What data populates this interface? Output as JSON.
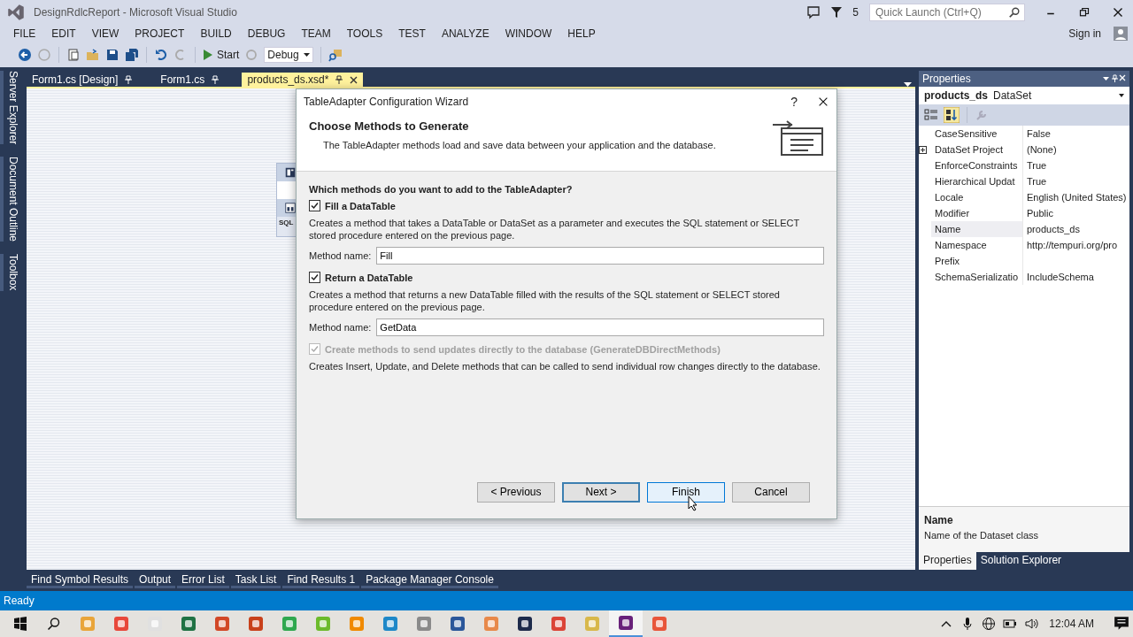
{
  "window": {
    "title": "DesignRdlcReport - Microsoft Visual Studio"
  },
  "notifications": {
    "count": "5"
  },
  "quick_launch": {
    "placeholder": "Quick Launch (Ctrl+Q)"
  },
  "menu": [
    "FILE",
    "EDIT",
    "VIEW",
    "PROJECT",
    "BUILD",
    "DEBUG",
    "TEAM",
    "TOOLS",
    "TEST",
    "ANALYZE",
    "WINDOW",
    "HELP"
  ],
  "sign_in": "Sign in",
  "toolbar": {
    "start": "Start",
    "configuration": "Debug"
  },
  "side_tabs": [
    "Server Explorer",
    "Document Outline",
    "Toolbox"
  ],
  "document_tabs": [
    {
      "label": "Form1.cs [Design]",
      "selected": false
    },
    {
      "label": "Form1.cs",
      "selected": false
    },
    {
      "label": "products_ds.xsd*",
      "selected": true
    }
  ],
  "designer": {
    "sql": "SQL"
  },
  "dialog": {
    "title": "TableAdapter Configuration Wizard",
    "help": "?",
    "heading": "Choose Methods to Generate",
    "description": "The TableAdapter methods load and save data between your application and the database.",
    "question": "Which methods do you want to add to the TableAdapter?",
    "options": [
      {
        "label": "Fill a DataTable",
        "checked": true,
        "disabled": false,
        "description": "Creates a method that takes a DataTable or DataSet as a parameter and executes the SQL statement or SELECT stored procedure entered on the previous page.",
        "method_label": "Method name:",
        "method_value": "Fill"
      },
      {
        "label": "Return a DataTable",
        "checked": true,
        "disabled": false,
        "description": "Creates a method that returns a new DataTable filled with the results of the SQL statement or SELECT stored procedure entered on the previous page.",
        "method_label": "Method name:",
        "method_value": "GetData"
      },
      {
        "label": "Create methods to send updates directly to the database (GenerateDBDirectMethods)",
        "checked": true,
        "disabled": true,
        "description": "Creates Insert, Update, and Delete methods that can be called to send individual row changes directly to the database."
      }
    ],
    "buttons": [
      {
        "label": "< Previous",
        "kind": "normal"
      },
      {
        "label": "Next >",
        "kind": "default"
      },
      {
        "label": "Finish",
        "kind": "hover"
      },
      {
        "label": "Cancel",
        "kind": "normal"
      }
    ]
  },
  "properties": {
    "title": "Properties",
    "object_name": "products_ds",
    "object_type": "DataSet",
    "rows": [
      {
        "name": "CaseSensitive",
        "value": "False",
        "expandable": false,
        "selected": false
      },
      {
        "name": "DataSet Project",
        "value": "(None)",
        "expandable": true,
        "selected": false
      },
      {
        "name": "EnforceConstraints",
        "value": "True",
        "expandable": false,
        "selected": false
      },
      {
        "name": "Hierarchical Updat",
        "value": "True",
        "expandable": false,
        "selected": false
      },
      {
        "name": "Locale",
        "value": "English (United States)",
        "expandable": false,
        "selected": false
      },
      {
        "name": "Modifier",
        "value": "Public",
        "expandable": false,
        "selected": false
      },
      {
        "name": "Name",
        "value": "products_ds",
        "expandable": false,
        "selected": true
      },
      {
        "name": "Namespace",
        "value": "http://tempuri.org/pro",
        "expandable": false,
        "selected": false
      },
      {
        "name": "Prefix",
        "expandable": false,
        "selected": false
      },
      {
        "name": "SchemaSerializatio",
        "value": "IncludeSchema",
        "expandable": false,
        "selected": false
      }
    ],
    "help_title": "Name",
    "help_text": "Name of the Dataset class",
    "tabs": [
      {
        "label": "Properties",
        "selected": true
      },
      {
        "label": "Solution Explorer",
        "selected": false
      }
    ]
  },
  "tool_tabs": [
    "Find Symbol Results",
    "Output",
    "Error List",
    "Task List",
    "Find Results 1",
    "Package Manager Console"
  ],
  "status": "Ready",
  "taskbar": {
    "apps": [
      {
        "selected": false
      },
      {
        "selected": false
      },
      {
        "selected": false
      },
      {
        "selected": false
      },
      {
        "selected": false
      },
      {
        "selected": false
      },
      {
        "selected": false
      },
      {
        "selected": false
      },
      {
        "selected": false
      },
      {
        "selected": false
      },
      {
        "selected": false
      },
      {
        "selected": false
      },
      {
        "selected": false
      },
      {
        "selected": false
      },
      {
        "selected": false
      },
      {
        "selected": false
      },
      {
        "selected": true
      },
      {
        "selected": false
      }
    ],
    "time": "12:04 AM"
  }
}
